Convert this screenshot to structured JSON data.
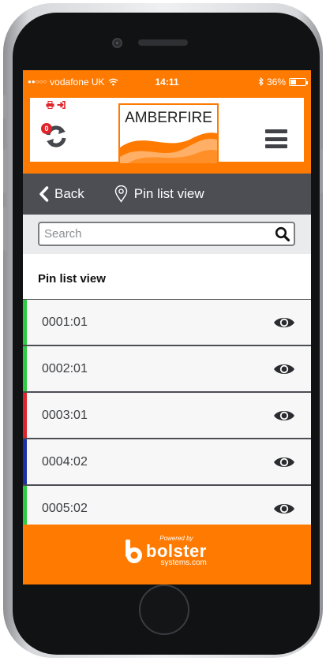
{
  "status_bar": {
    "signal": "●●○○○",
    "carrier": "vodafone UK",
    "time": "14:11",
    "battery": "36%"
  },
  "header": {
    "sync_badge_count": "0",
    "logo_text": "AMBERFIRE"
  },
  "nav": {
    "back_label": "Back",
    "title": "Pin list view"
  },
  "search": {
    "placeholder": "Search"
  },
  "section_title": "Pin list view",
  "pins": [
    {
      "label": "0001:01",
      "status_color": "#2ecc40"
    },
    {
      "label": "0002:01",
      "status_color": "#2ecc40"
    },
    {
      "label": "0003:01",
      "status_color": "#e0242b"
    },
    {
      "label": "0004:02",
      "status_color": "#1f2fa8"
    },
    {
      "label": "0005:02",
      "status_color": "#2ecc40"
    }
  ],
  "footer": {
    "powered_by": "Powered by",
    "brand": "bolster",
    "brand_sub": "systems.com"
  },
  "colors": {
    "accent": "#ff7a00",
    "nav_background": "#4c4e54",
    "alert_red": "#e0242b"
  },
  "icons": {
    "print": "print-icon",
    "logout": "sign-in-icon",
    "sync": "sync-icon",
    "menu": "hamburger-menu-icon",
    "back": "chevron-left-icon",
    "location": "map-pin-icon",
    "search": "search-icon",
    "view": "eye-icon"
  }
}
